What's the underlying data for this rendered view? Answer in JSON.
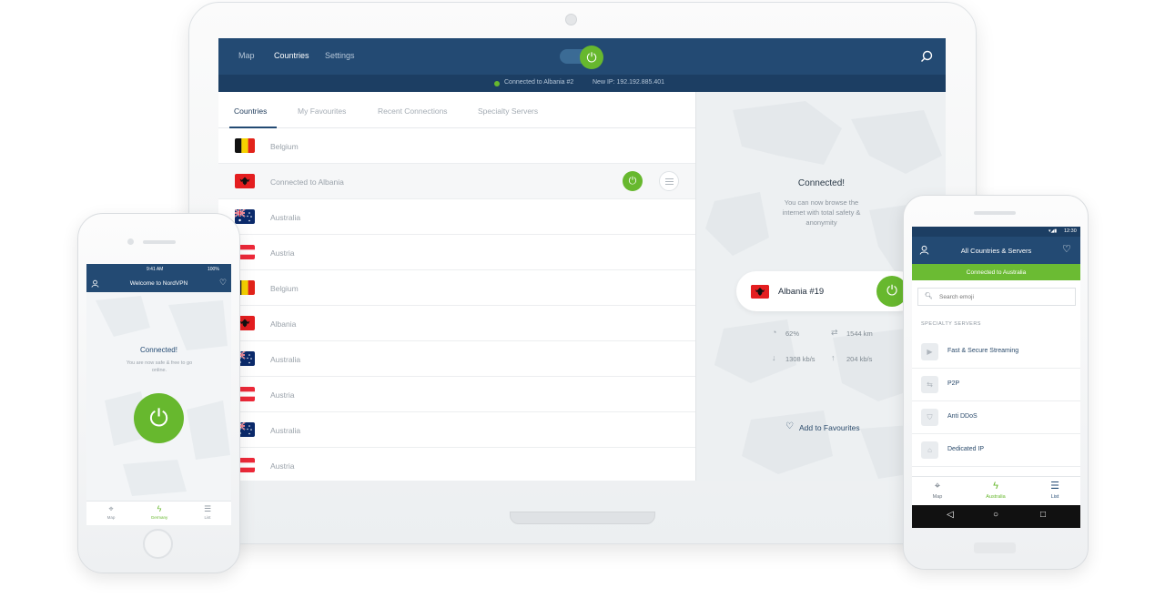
{
  "laptop": {
    "nav": [
      "Map",
      "Countries",
      "Settings"
    ],
    "active_nav": "Countries",
    "status": "Connected to Albania #2",
    "new_ip": "New IP: 192.192.885.401",
    "tabs": [
      "Countries",
      "My Favourites",
      "Recent Connections",
      "Specialty Servers"
    ],
    "rows": [
      {
        "name": "Belgium",
        "flag": "belgium"
      },
      {
        "name": "Connected to Albania",
        "flag": "albania"
      },
      {
        "name": "Australia",
        "flag": "australia"
      },
      {
        "name": "Austria",
        "flag": "austria"
      },
      {
        "name": "Belgium",
        "flag": "belgium"
      },
      {
        "name": "Albania",
        "flag": "albania"
      },
      {
        "name": "Australia",
        "flag": "australia"
      },
      {
        "name": "Austria",
        "flag": "austria"
      },
      {
        "name": "Australia",
        "flag": "australia"
      },
      {
        "name": "Austria",
        "flag": "austria"
      }
    ],
    "panel": {
      "title": "Connected!",
      "subtitle": "You can now browse the internet with total safety & anonymity",
      "server": "Albania #19",
      "load": "62%",
      "distance": "1544 km",
      "download": "1308 kb/s",
      "upload": "204 kb/s",
      "favourite": "Add to Favourites"
    }
  },
  "iphone": {
    "time": "9:41 AM",
    "battery": "100%",
    "title": "Welcome to NordVPN",
    "connected": "Connected!",
    "subtitle": "You are now safe & free to go online.",
    "tabs": [
      "Map",
      "Germany",
      "List"
    ],
    "active_tab": "Germany"
  },
  "android": {
    "time": "12:30",
    "title": "All Countries & Servers",
    "banner": "Connected to Australia",
    "search_placeholder": "Search emoji",
    "section": "SPECIALTY SERVERS",
    "items": [
      "Fast & Secure Streaming",
      "P2P",
      "Anti DDoS",
      "Dedicated IP"
    ],
    "tabs": [
      "Map",
      "Australia",
      "List"
    ],
    "active_tab": "Australia"
  },
  "colors": {
    "navy": "#234a73",
    "accent_green": "#67b82e",
    "banner_green": "#6bbb33",
    "map_grey": "#edf0f2"
  },
  "icons": [
    "search-icon",
    "power-icon",
    "menu-icon",
    "load-icon",
    "distance-icon",
    "download-icon",
    "upload-icon",
    "heart-icon",
    "user-icon",
    "map-pin-icon",
    "bolt-icon",
    "list-icon",
    "play-icon",
    "shield-icon",
    "home-icon"
  ]
}
